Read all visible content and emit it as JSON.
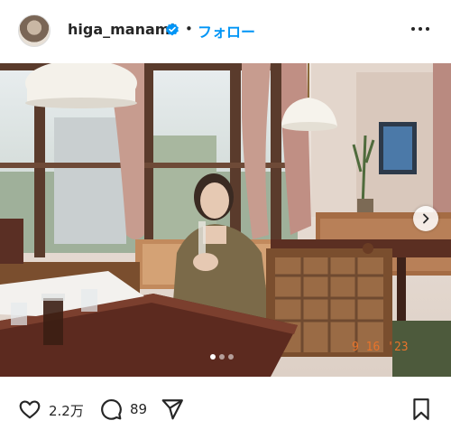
{
  "post": {
    "username": "higa_manami",
    "separator": "•",
    "follow_label": "フォロー",
    "carousel": {
      "total": 3,
      "active": 1
    },
    "photo_date_stamp": "9 16 '23"
  },
  "actions": {
    "likes": "2.2万",
    "comments": "89"
  },
  "colors": {
    "verified_blue": "#0095f6",
    "follow_blue": "#0095f6",
    "text": "#262626"
  },
  "icons": {
    "verified": "verified-badge-icon",
    "more": "more-options-icon",
    "next": "chevron-right-icon",
    "like": "heart-icon",
    "comment": "comment-icon",
    "share": "paper-plane-icon",
    "save": "bookmark-icon"
  }
}
